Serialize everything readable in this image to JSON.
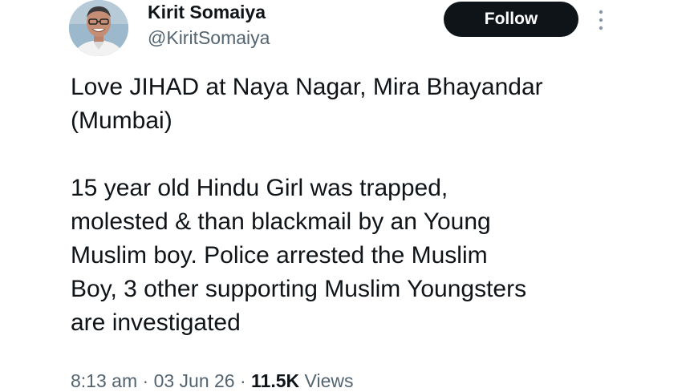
{
  "author": {
    "name": "Kirit Somaiya",
    "handle": "@KiritSomaiya",
    "avatar_icon": "profile-photo"
  },
  "actions": {
    "follow_label": "Follow",
    "more_icon": "vertical-ellipsis-icon"
  },
  "tweet": {
    "line1": "Love JIHAD at Naya Nagar, Mira Bhayandar",
    "line2": "(Mumbai)",
    "line3": "15 year old Hindu Girl was trapped,",
    "line4": "molested & than blackmail by an Young",
    "line5": "Muslim boy. Police arrested the Muslim",
    "line6": "Boy, 3 other supporting Muslim Youngsters",
    "line7": "are investigated"
  },
  "meta": {
    "time": "8:13 am",
    "date": "03 Jun 26",
    "views_count": "11.5K",
    "views_label": "Views",
    "separator": "·"
  },
  "colors": {
    "text_primary": "#0f1419",
    "text_secondary": "#536471",
    "button_bg": "#0f1419",
    "button_text": "#ffffff"
  }
}
